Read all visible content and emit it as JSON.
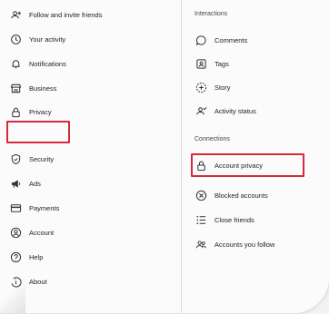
{
  "left_menu": {
    "items": [
      {
        "label": "Follow and invite friends",
        "icon": "add-person-icon"
      },
      {
        "label": "Your activity",
        "icon": "activity-clock-icon"
      },
      {
        "label": "Notifications",
        "icon": "bell-icon"
      },
      {
        "label": "Business",
        "icon": "shop-icon"
      },
      {
        "label": "Privacy",
        "icon": "lock-icon"
      },
      {
        "label": "Security",
        "icon": "shield-icon"
      },
      {
        "label": "Ads",
        "icon": "megaphone-icon"
      },
      {
        "label": "Payments",
        "icon": "card-icon"
      },
      {
        "label": "Account",
        "icon": "account-icon"
      },
      {
        "label": "Help",
        "icon": "help-icon"
      },
      {
        "label": "About",
        "icon": "info-icon"
      }
    ]
  },
  "right_menu": {
    "interactions_header": "Interactions",
    "interactions": [
      {
        "label": "Comments",
        "icon": "comment-icon"
      },
      {
        "label": "Tags",
        "icon": "tag-icon"
      },
      {
        "label": "Story",
        "icon": "story-icon"
      },
      {
        "label": "Activity status",
        "icon": "activity-status-icon"
      }
    ],
    "connections_header": "Connections",
    "connections": [
      {
        "label": "Account privacy",
        "icon": "lock-icon"
      },
      {
        "label": "Blocked accounts",
        "icon": "blocked-icon"
      },
      {
        "label": "Close friends",
        "icon": "list-icon"
      },
      {
        "label": "Accounts you follow",
        "icon": "people-icon"
      }
    ]
  },
  "highlight_color": "#d8283b"
}
